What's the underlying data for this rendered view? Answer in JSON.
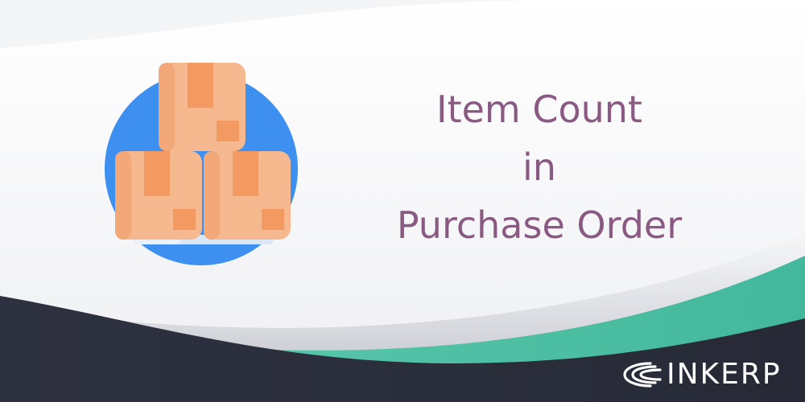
{
  "title": {
    "line1": "Item Count",
    "line2": "in",
    "line3": "Purchase Order"
  },
  "brand": {
    "name": "INKERP"
  },
  "colors": {
    "title": "#8a5a82",
    "dark_band": "#2c2f3c",
    "teal_band": "#4fbfa5",
    "circle": "#3d8ff0",
    "box": "#f6b98f",
    "box_tape": "#f39a62"
  },
  "icons": {
    "illustration": "stacked-boxes-icon",
    "logo": "inkerp-logo-icon"
  }
}
